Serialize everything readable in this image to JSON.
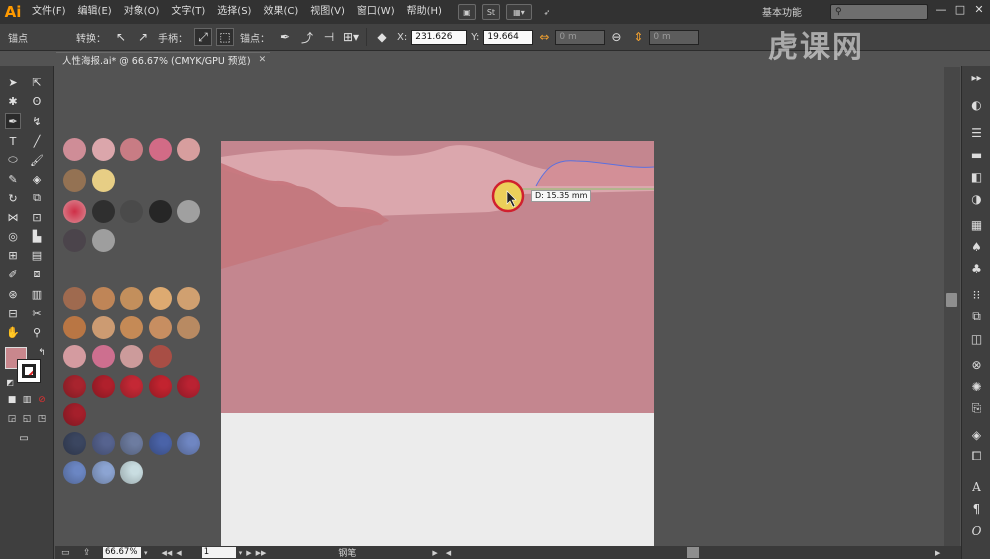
{
  "menubar": {
    "logo": "Ai",
    "items": [
      "文件(F)",
      "编辑(E)",
      "对象(O)",
      "文字(T)",
      "选择(S)",
      "效果(C)",
      "视图(V)",
      "窗口(W)",
      "帮助(H)"
    ],
    "st_label": "St",
    "workspace": "基本功能"
  },
  "controlbar": {
    "anchor_label": "锚点",
    "convert_label": "转换：",
    "handles_label": "手柄：",
    "anchors_label": "锚点：",
    "x_value": "231.626",
    "y_value": "19.664",
    "w_value": "0 m",
    "h_value": "0 m"
  },
  "watermark": "虎课网",
  "document": {
    "tab_title": "人性海报.ai* @ 66.67% (CMYK/GPU 预览)"
  },
  "measure_label": "D: 15.35 mm",
  "statusbar": {
    "zoom": "66.67%",
    "page": "1",
    "tool_name": "钢笔"
  },
  "colors": {
    "accent": "#ff9a00",
    "artboard_sky": "#c4868f",
    "artboard_bg": "#ececec",
    "fill_swatch": "#c9878d"
  },
  "swatches": [
    {
      "color": "#cf8d97"
    },
    {
      "color": "#dba6ab"
    },
    {
      "color": "#c87c84"
    },
    {
      "color": "#d26b86"
    },
    {
      "color": "#d79e9e"
    },
    {
      "color": "#947253"
    },
    {
      "color": "#e7ce85"
    },
    {
      "color": "#d8717f",
      "inner": "#cf2f47"
    },
    {
      "color": "#2f2f2f"
    },
    {
      "color": "#4a4a4a"
    },
    {
      "color": "#262626"
    },
    {
      "color": "#a0a0a0"
    },
    {
      "color": "#4b444b"
    },
    {
      "color": "#9e9e9e"
    },
    {
      "color": "#9f6a4f"
    },
    {
      "color": "#bf8557"
    },
    {
      "color": "#c38f5c"
    },
    {
      "color": "#ddaa71"
    },
    {
      "color": "#d0a070"
    },
    {
      "color": "#b97644"
    },
    {
      "color": "#cc9b72"
    },
    {
      "color": "#c58a56"
    },
    {
      "color": "#c78e61"
    },
    {
      "color": "#b88a62"
    },
    {
      "color": "#d49ba0"
    },
    {
      "color": "#cd6f8f"
    },
    {
      "color": "#cc9b9b"
    },
    {
      "color": "#a84e45"
    },
    {
      "color": "#a8242e"
    },
    {
      "color": "#b0202c"
    },
    {
      "color": "#c42835"
    },
    {
      "color": "#c2232f"
    },
    {
      "color": "#ba2232"
    },
    {
      "color": "#a51f2b"
    },
    {
      "color": "#3b4660"
    },
    {
      "color": "#56638f"
    },
    {
      "color": "#6d7ca0"
    },
    {
      "color": "#4a63a8"
    },
    {
      "color": "#6f86c2"
    },
    {
      "color": "#6b86c3"
    },
    {
      "color": "#8ca4d2"
    },
    {
      "color": "#c9dde1"
    }
  ]
}
